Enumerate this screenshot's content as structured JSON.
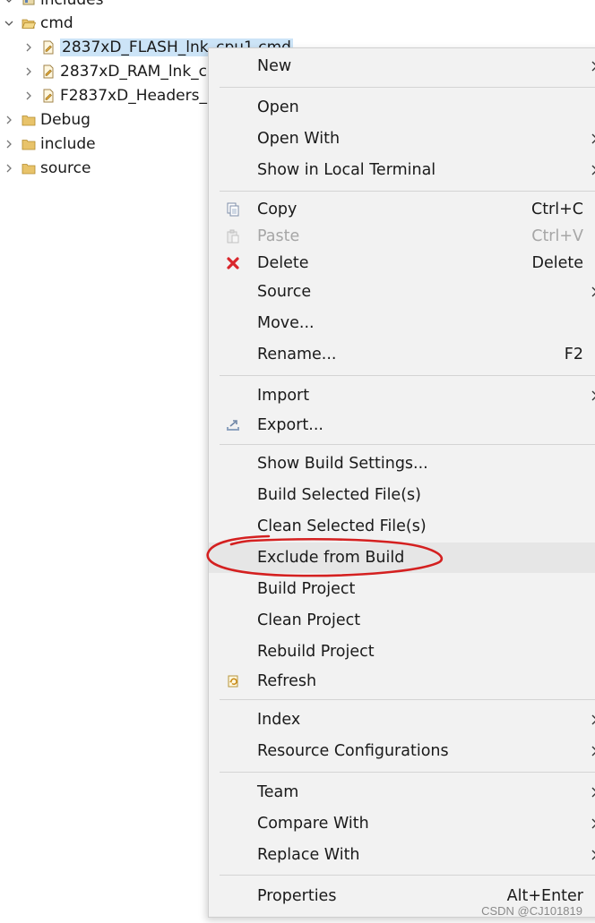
{
  "tree": {
    "items": [
      {
        "label": "includes",
        "expanded": false
      },
      {
        "label": "cmd",
        "expanded": true
      },
      {
        "label": "2837xD_FLASH_lnk_cpu1.cmd",
        "selected": true
      },
      {
        "label": "2837xD_RAM_lnk_c"
      },
      {
        "label": "F2837xD_Headers_"
      },
      {
        "label": "Debug"
      },
      {
        "label": "include"
      },
      {
        "label": "source"
      }
    ]
  },
  "menu": {
    "new": "New",
    "open": "Open",
    "open_with": "Open With",
    "show_in_local_terminal": "Show in Local Terminal",
    "copy": "Copy",
    "copy_shortcut": "Ctrl+C",
    "paste": "Paste",
    "paste_shortcut": "Ctrl+V",
    "delete": "Delete",
    "delete_shortcut": "Delete",
    "source": "Source",
    "move": "Move...",
    "rename": "Rename...",
    "rename_shortcut": "F2",
    "import": "Import",
    "export": "Export...",
    "show_build_settings": "Show Build Settings...",
    "build_selected_files": "Build Selected File(s)",
    "clean_selected_files": "Clean Selected File(s)",
    "exclude_from_build": "Exclude from Build",
    "build_project": "Build Project",
    "clean_project": "Clean Project",
    "rebuild_project": "Rebuild Project",
    "refresh": "Refresh",
    "index": "Index",
    "resource_configurations": "Resource Configurations",
    "team": "Team",
    "compare_with": "Compare With",
    "replace_with": "Replace With",
    "properties": "Properties",
    "properties_shortcut": "Alt+Enter"
  },
  "watermark": "CSDN @CJ101819",
  "colors": {
    "selection": "#cce4f7",
    "annotation": "#d42020",
    "delete_icon": "#d9262c"
  }
}
